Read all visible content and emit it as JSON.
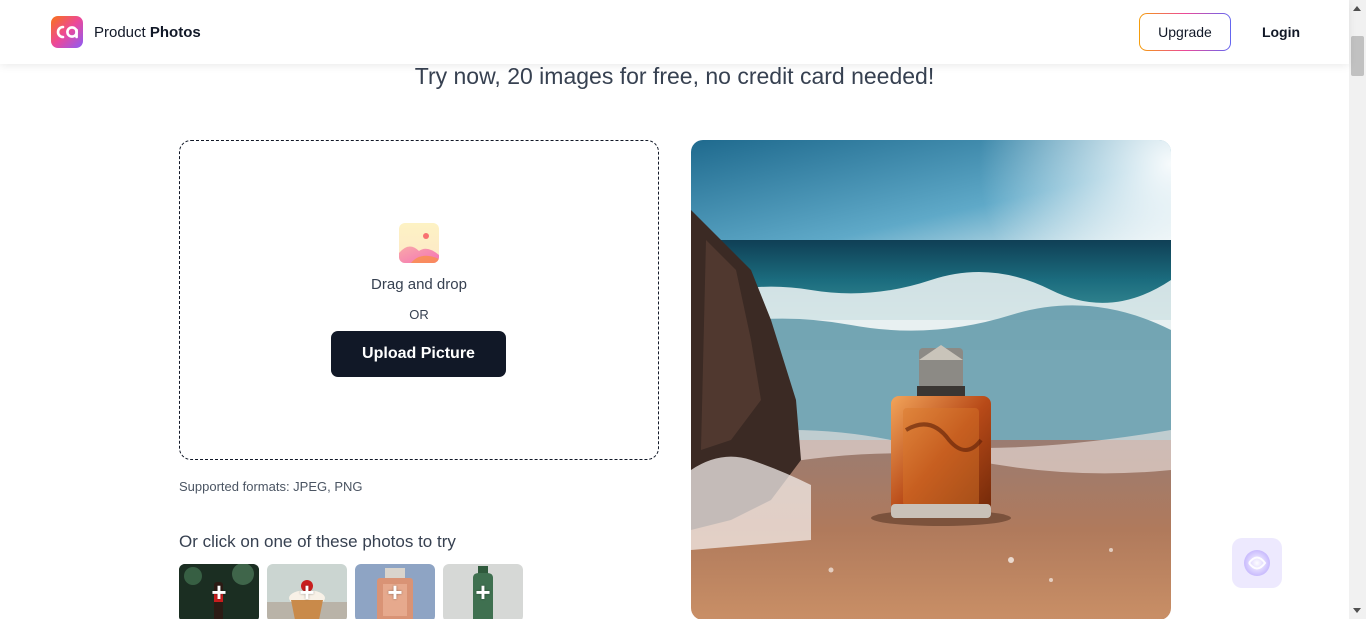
{
  "header": {
    "brand_prefix": "Product",
    "brand_bold": "Photos",
    "upgrade_label": "Upgrade",
    "login_label": "Login",
    "logo_icon": "ca-logo-icon"
  },
  "main": {
    "tagline": "Try now, 20 images for free, no credit card needed!",
    "upload": {
      "icon": "image-placeholder-icon",
      "drag_text": "Drag and drop",
      "or_text": "OR",
      "button_label": "Upload Picture"
    },
    "formats_text": "Supported formats: JPEG, PNG",
    "samples_heading": "Or click on one of these photos to try",
    "samples": [
      {
        "name": "sample-bottle-forest",
        "plus": "+"
      },
      {
        "name": "sample-cupcake",
        "plus": "+"
      },
      {
        "name": "sample-perfume",
        "plus": "+"
      },
      {
        "name": "sample-green-bottle",
        "plus": "+"
      }
    ]
  },
  "colors": {
    "primary_button": "#111827",
    "accent_gradient": [
      "#f59e0b",
      "#ec4899",
      "#6366f1"
    ]
  }
}
